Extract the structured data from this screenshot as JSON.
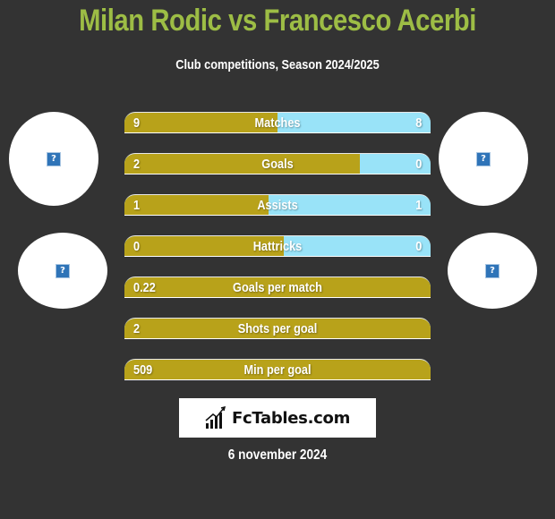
{
  "header": {
    "title": "Milan Rodic vs Francesco Acerbi",
    "subtitle": "Club competitions, Season 2024/2025"
  },
  "colors": {
    "title": "#9dbd45",
    "left_bar": "#b8a21a",
    "right_bar": "#99e3f8",
    "background": "#333333"
  },
  "players": {
    "left": {
      "name": "Milan Rodic",
      "avatar_icon": "broken-image-icon",
      "club_icon": "broken-image-icon"
    },
    "right": {
      "name": "Francesco Acerbi",
      "avatar_icon": "broken-image-icon",
      "club_icon": "broken-image-icon"
    }
  },
  "stats": [
    {
      "label": "Matches",
      "left": "9",
      "right": "8",
      "left_share": 0.5
    },
    {
      "label": "Goals",
      "left": "2",
      "right": "0",
      "left_share": 0.77
    },
    {
      "label": "Assists",
      "left": "1",
      "right": "1",
      "left_share": 0.47
    },
    {
      "label": "Hattricks",
      "left": "0",
      "right": "0",
      "left_share": 0.52
    },
    {
      "label": "Goals per match",
      "left": "0.22",
      "right": "",
      "left_share": 1.0
    },
    {
      "label": "Shots per goal",
      "left": "2",
      "right": "",
      "left_share": 1.0
    },
    {
      "label": "Min per goal",
      "left": "509",
      "right": "",
      "left_share": 1.0
    }
  ],
  "logo": {
    "text": "FcTables.com",
    "icon": "bar-chart-icon"
  },
  "footer": {
    "date": "6 november 2024"
  }
}
